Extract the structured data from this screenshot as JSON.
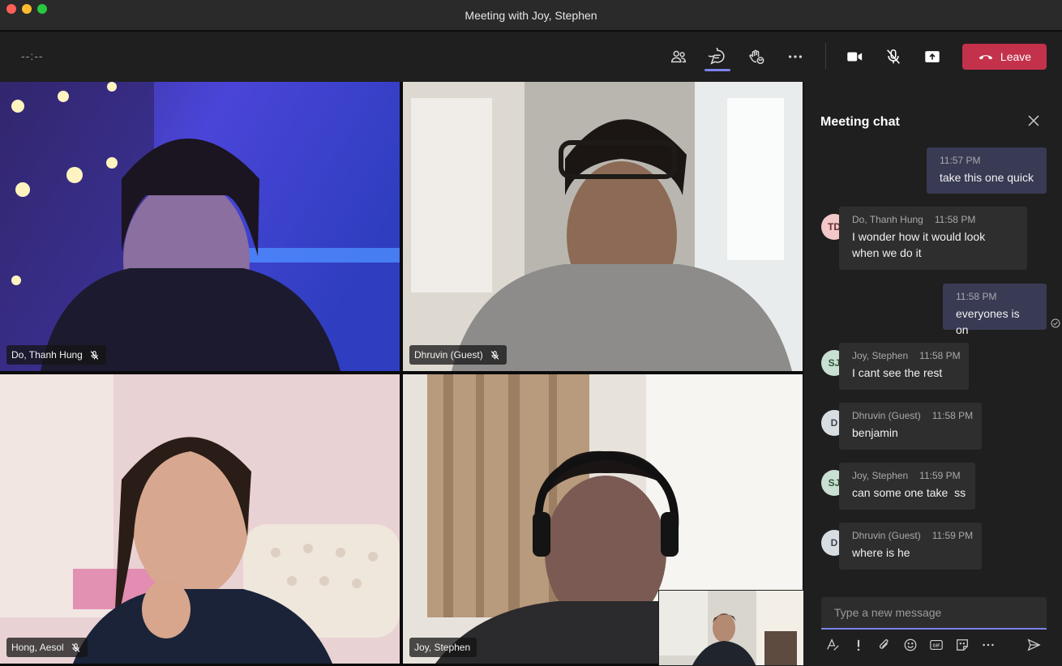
{
  "window": {
    "title": "Meeting with Joy, Stephen"
  },
  "toolbar": {
    "timer": "--:--",
    "leave_label": "Leave",
    "icons": [
      "people-icon",
      "chat-icon",
      "reactions-icon",
      "more-icon",
      "camera-icon",
      "mic-off-icon",
      "share-icon",
      "hangup-icon"
    ]
  },
  "participants": [
    {
      "name": "Do, Thanh Hung",
      "muted": true
    },
    {
      "name": "Dhruvin (Guest)",
      "muted": true
    },
    {
      "name": "Hong, Aesol",
      "muted": true
    },
    {
      "name": "Joy, Stephen",
      "muted": false
    }
  ],
  "chat": {
    "title": "Meeting chat",
    "placeholder": "Type a new message",
    "messages": [
      {
        "mine": true,
        "author": "",
        "time": "11:57 PM",
        "text": "take this one quick"
      },
      {
        "mine": false,
        "author": "Do, Thanh Hung",
        "initials": "TD",
        "time": "11:58 PM",
        "text_lines": [
          "I wonder how it would look",
          "when we do it"
        ]
      },
      {
        "mine": true,
        "author": "",
        "time": "11:58 PM",
        "text": "everyones is on"
      },
      {
        "mine": false,
        "author": "Joy, Stephen",
        "initials": "SJ",
        "time": "11:58 PM",
        "text": "I cant see the rest"
      },
      {
        "mine": false,
        "author": "Dhruvin (Guest)",
        "initials": "D",
        "time": "11:58 PM",
        "text": "benjamin"
      },
      {
        "mine": false,
        "author": "Joy, Stephen",
        "initials": "SJ",
        "time": "11:59 PM",
        "text": "can some one take  ss"
      },
      {
        "mine": false,
        "author": "Dhruvin (Guest)",
        "initials": "D",
        "time": "11:59 PM",
        "text": "where is he"
      }
    ]
  },
  "colors": {
    "accent": "#7b83eb",
    "leave": "#c4314b",
    "presence_busy": "#c4314b"
  }
}
